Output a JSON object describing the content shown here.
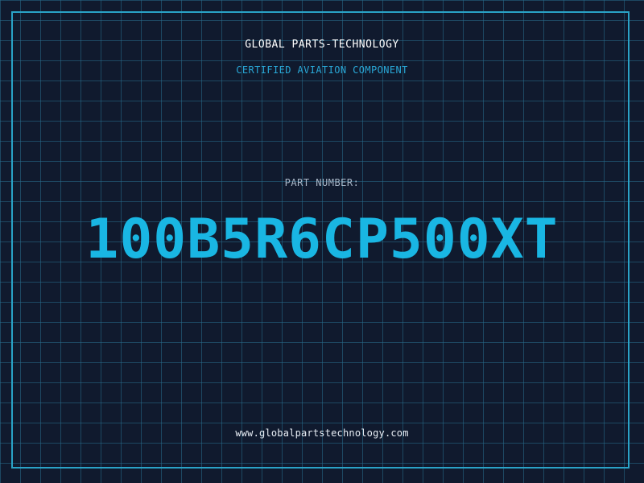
{
  "header": {
    "company_name": "GLOBAL PARTS-TECHNOLOGY",
    "tagline": "CERTIFIED AVIATION COMPONENT"
  },
  "part": {
    "label": "PART NUMBER:",
    "number": "100B5R6CP500XT"
  },
  "footer": {
    "website": "www.globalpartstechnology.com"
  },
  "colors": {
    "background": "#101a2e",
    "grid": "#286e8c",
    "frame": "#2aa3c7",
    "accent": "#19b6e3",
    "tagline": "#29a7d6"
  }
}
